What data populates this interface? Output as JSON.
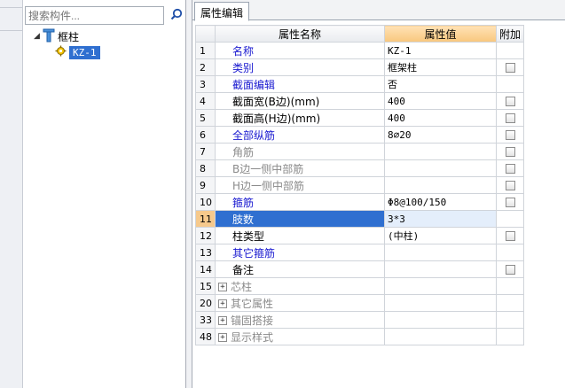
{
  "search": {
    "placeholder": "搜索构件..."
  },
  "tree": {
    "root": {
      "label": "框柱"
    },
    "child": {
      "label": "KZ-1"
    }
  },
  "tab": {
    "label": "属性编辑"
  },
  "grid": {
    "headers": {
      "name": "属性名称",
      "value": "属性值",
      "extra": "附加"
    },
    "rows": [
      {
        "num": "1",
        "name": "名称",
        "value": "KZ-1",
        "color": "blue",
        "checkbox": false,
        "expand": false
      },
      {
        "num": "2",
        "name": "类别",
        "value": "框架柱",
        "color": "blue",
        "checkbox": true,
        "expand": false
      },
      {
        "num": "3",
        "name": "截面编辑",
        "value": "否",
        "color": "blue",
        "checkbox": false,
        "expand": false
      },
      {
        "num": "4",
        "name": "截面宽(B边)(mm)",
        "value": "400",
        "color": "black",
        "checkbox": true,
        "expand": false
      },
      {
        "num": "5",
        "name": "截面高(H边)(mm)",
        "value": "400",
        "color": "black",
        "checkbox": true,
        "expand": false
      },
      {
        "num": "6",
        "name": "全部纵筋",
        "value": "8⌀20",
        "color": "blue",
        "checkbox": true,
        "expand": false
      },
      {
        "num": "7",
        "name": "角筋",
        "value": "",
        "color": "gray",
        "checkbox": true,
        "expand": false
      },
      {
        "num": "8",
        "name": "B边一侧中部筋",
        "value": "",
        "color": "gray",
        "checkbox": true,
        "expand": false
      },
      {
        "num": "9",
        "name": "H边一侧中部筋",
        "value": "",
        "color": "gray",
        "checkbox": true,
        "expand": false
      },
      {
        "num": "10",
        "name": "箍筋",
        "value": "Φ8@100/150",
        "color": "blue",
        "checkbox": true,
        "expand": false
      },
      {
        "num": "11",
        "name": "肢数",
        "value": "3*3",
        "color": "blue",
        "checkbox": false,
        "expand": false,
        "selected": true
      },
      {
        "num": "12",
        "name": "柱类型",
        "value": "(中柱)",
        "color": "black",
        "checkbox": true,
        "expand": false
      },
      {
        "num": "13",
        "name": "其它箍筋",
        "value": "",
        "color": "blue",
        "checkbox": false,
        "expand": false
      },
      {
        "num": "14",
        "name": "备注",
        "value": "",
        "color": "black",
        "checkbox": true,
        "expand": false
      },
      {
        "num": "15",
        "name": "芯柱",
        "value": "",
        "color": "gray",
        "checkbox": false,
        "expand": true
      },
      {
        "num": "20",
        "name": "其它属性",
        "value": "",
        "color": "gray",
        "checkbox": false,
        "expand": true
      },
      {
        "num": "33",
        "name": "锚固搭接",
        "value": "",
        "color": "gray",
        "checkbox": false,
        "expand": true
      },
      {
        "num": "48",
        "name": "显示样式",
        "value": "",
        "color": "gray",
        "checkbox": false,
        "expand": true
      }
    ]
  }
}
